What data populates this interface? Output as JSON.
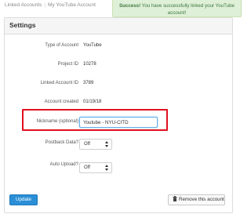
{
  "breadcrumb": {
    "items": [
      "Linked Accounts",
      "My YouTube Account"
    ],
    "separator": "|"
  },
  "alert": {
    "strong": "Success!",
    "message": "You have successfully linked your YouTube account!"
  },
  "settings": {
    "title": "Settings",
    "fields": [
      {
        "label": "Type of Account",
        "value": "YouTube"
      },
      {
        "label": "Project ID",
        "value": "10278"
      },
      {
        "label": "Linked Account ID",
        "value": "3789"
      },
      {
        "label": "Account created",
        "value": "01/19/18"
      }
    ],
    "nickname": {
      "label": "Nickname (optional)",
      "value": "Youtube - NYU-CITD"
    },
    "postback": {
      "label": "Postback Data?",
      "selected": "Off"
    },
    "autoupload": {
      "label": "Auto Upload?",
      "selected": "Off"
    }
  },
  "actions": {
    "update_label": "Update",
    "remove_label": "Remove this account"
  },
  "colors": {
    "primary_button": "#2a8fd6",
    "success_bg": "#dff0d8",
    "success_text": "#3c763d",
    "highlight_box": "#e0101e"
  },
  "icons": {
    "select_arrows": "up-down-arrows-icon",
    "remove": "trash-icon"
  }
}
